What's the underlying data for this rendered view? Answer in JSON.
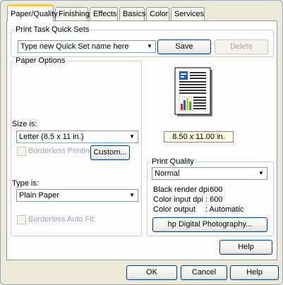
{
  "tabs": [
    {
      "label": "Paper/Quality",
      "active": true
    },
    {
      "label": "Finishing"
    },
    {
      "label": "Effects"
    },
    {
      "label": "Basics"
    },
    {
      "label": "Color"
    },
    {
      "label": "Services"
    }
  ],
  "quick_sets": {
    "legend": "Print Task Quick Sets",
    "value": "Type new Quick Set name here",
    "save_label": "Save",
    "delete_label": "Delete"
  },
  "paper_options": {
    "legend": "Paper Options",
    "size_label": "Size is:",
    "size_value": "Letter (8.5 x 11 in.)",
    "borderless_printing_label": "Borderless Printing",
    "custom_label": "Custom...",
    "type_label": "Type is:",
    "type_value": "Plain Paper",
    "borderless_autofit_label": "Borderless Auto Fit"
  },
  "preview": {
    "size_text": "8.50 x 11.00 in.",
    "icon": "document-preview-icon"
  },
  "print_quality": {
    "legend": "Print Quality",
    "value": "Normal",
    "details": [
      {
        "label": "Black render dpi",
        "value": ": 600"
      },
      {
        "label": "Color input dpi",
        "value": ": 600"
      },
      {
        "label": "Color output",
        "value": ": Automatic"
      }
    ],
    "hp_button_label": "hp Digital Photography..."
  },
  "help_label": "Help",
  "footer": {
    "ok_label": "OK",
    "cancel_label": "Cancel",
    "help_label": "Help"
  },
  "colors": {
    "window_bg": "#ece9d8",
    "tab_accent": "#ffc83c",
    "tooltip_bg": "#ffffe1"
  }
}
